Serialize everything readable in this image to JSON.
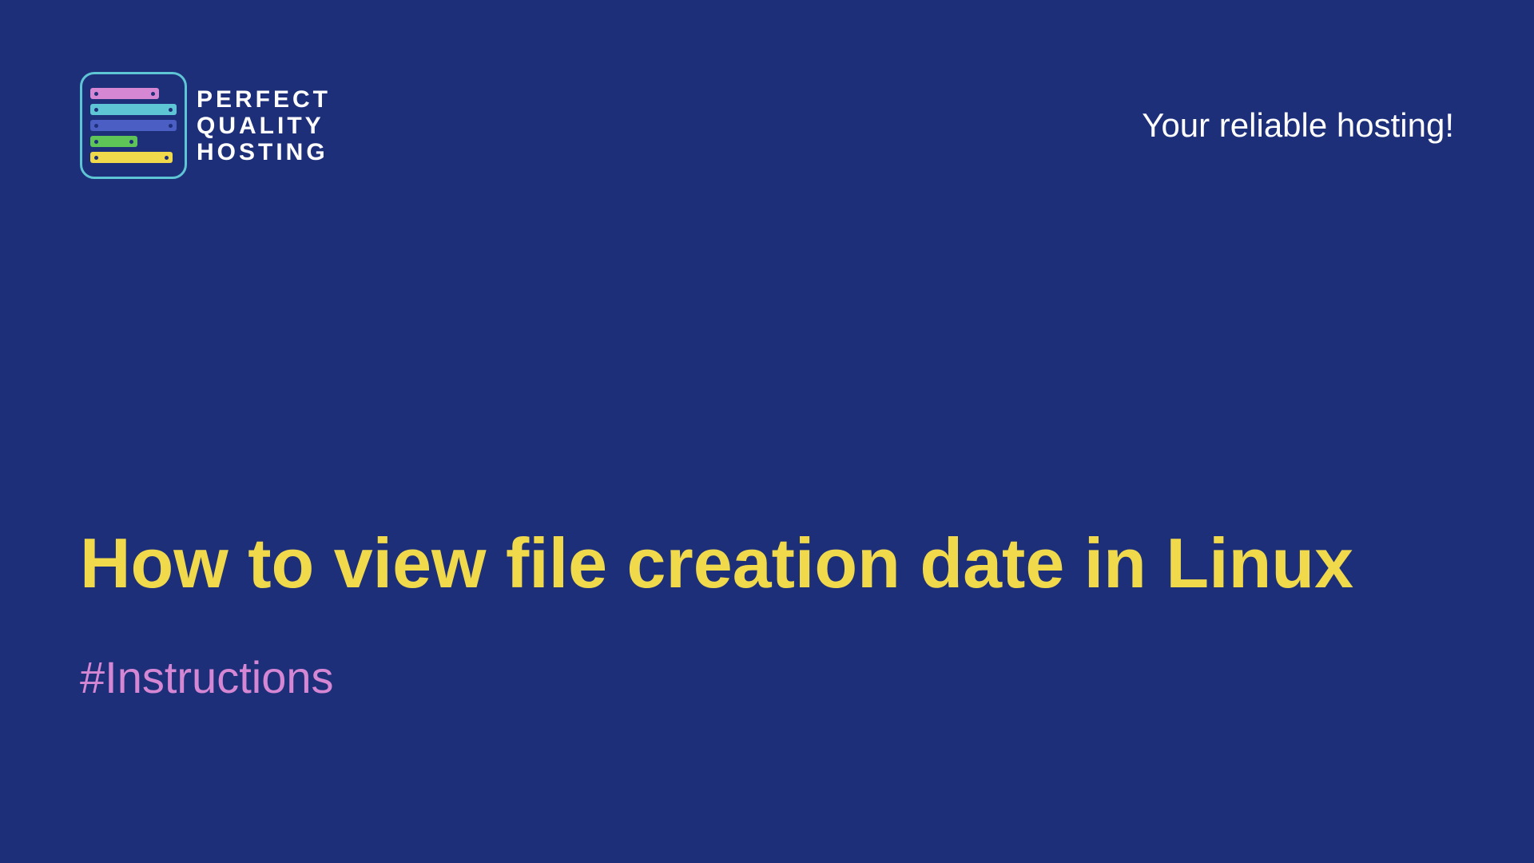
{
  "brand": {
    "line1": "PERFECT",
    "line2": "QUALITY",
    "line3": "HOSTING"
  },
  "tagline": "Your reliable hosting!",
  "title": "How to view file creation date in Linux",
  "tag": "#Instructions",
  "colors": {
    "background": "#1e2f7a",
    "titleColor": "#f0d94a",
    "tagColor": "#d687d4",
    "logoBorder": "#5ec5d4"
  }
}
